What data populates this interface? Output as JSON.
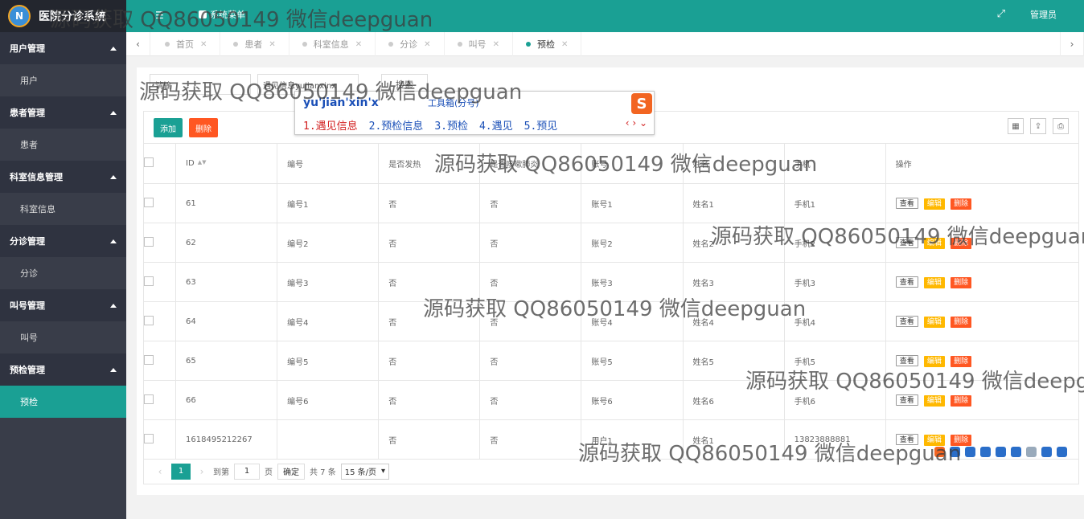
{
  "app": {
    "title": "医院分诊系统",
    "logo_text": "N"
  },
  "topbar": {
    "menu_label": "系统菜单",
    "user_label": "管理员"
  },
  "sidebar": [
    {
      "group": "用户管理",
      "item": "用户",
      "active": false
    },
    {
      "group": "患者管理",
      "item": "患者",
      "active": false
    },
    {
      "group": "科室信息管理",
      "item": "科室信息",
      "active": false
    },
    {
      "group": "分诊管理",
      "item": "分诊",
      "active": false
    },
    {
      "group": "叫号管理",
      "item": "叫号",
      "active": false
    },
    {
      "group": "预检管理",
      "item": "预检",
      "active": true
    }
  ],
  "tabs": [
    {
      "label": "首页",
      "active": false
    },
    {
      "label": "患者",
      "active": false
    },
    {
      "label": "科室信息",
      "active": false
    },
    {
      "label": "分诊",
      "active": false
    },
    {
      "label": "叫号",
      "active": false
    },
    {
      "label": "预检",
      "active": true
    }
  ],
  "search": {
    "field1": "请输",
    "field2": "遇见信息yujianxinx",
    "button": "搜索"
  },
  "ime": {
    "pinyin": "yu'jian'xin'x",
    "toolbox": "工具箱(分号)",
    "candidates": [
      "1.遇见信息",
      "2.预检信息",
      "3.预检",
      "4.遇见",
      "5.预见"
    ]
  },
  "toolbar": {
    "add": "添加",
    "delete": "删除"
  },
  "table": {
    "headers": [
      "ID",
      "编号",
      "是否发热",
      "是否咳嗽肺炎",
      "账号",
      "姓名",
      "手机",
      "操作"
    ],
    "rows": [
      [
        "61",
        "编号1",
        "否",
        "否",
        "账号1",
        "姓名1",
        "手机1"
      ],
      [
        "62",
        "编号2",
        "否",
        "否",
        "账号2",
        "姓名2",
        "手机2"
      ],
      [
        "63",
        "编号3",
        "否",
        "否",
        "账号3",
        "姓名3",
        "手机3"
      ],
      [
        "64",
        "编号4",
        "否",
        "否",
        "账号4",
        "姓名4",
        "手机4"
      ],
      [
        "65",
        "编号5",
        "否",
        "否",
        "账号5",
        "姓名5",
        "手机5"
      ],
      [
        "66",
        "编号6",
        "否",
        "否",
        "账号6",
        "姓名6",
        "手机6"
      ],
      [
        "1618495212267",
        "",
        "否",
        "否",
        "用户1",
        "姓名1",
        "13823888881"
      ]
    ],
    "actions": {
      "view": "查看",
      "edit": "编辑",
      "delete": "删除"
    }
  },
  "pager": {
    "current": "1",
    "goto_label": "到第",
    "goto_value": "1",
    "page_unit": "页",
    "confirm": "确定",
    "total": "共 7 条",
    "per_page": "15 条/页"
  },
  "watermark": "源码获取 QQ86050149 微信deepguan",
  "colors": {
    "accent": "#1aa094",
    "sidebar": "#393d49",
    "danger": "#ff5722",
    "warn": "#ffb800"
  }
}
